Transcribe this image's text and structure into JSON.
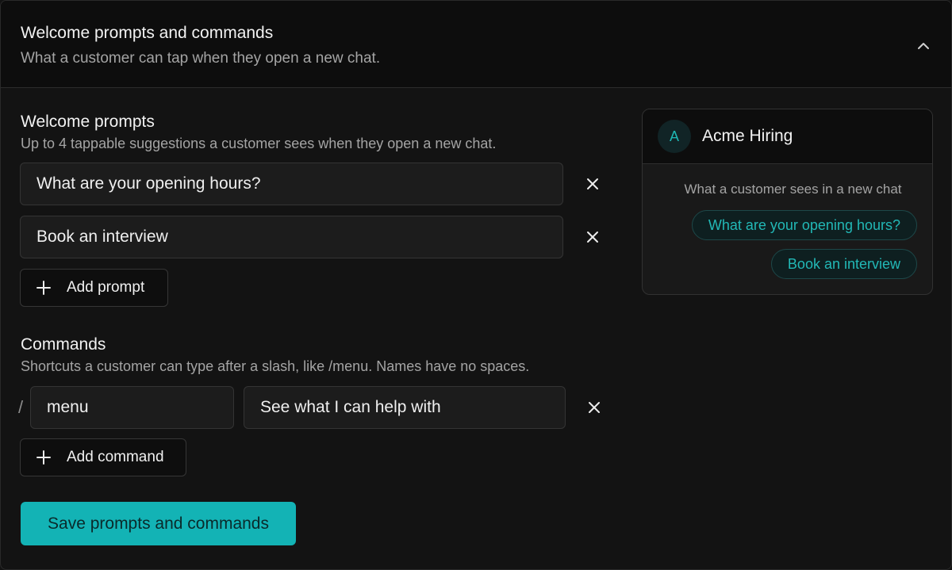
{
  "header": {
    "title": "Welcome prompts and commands",
    "subtitle": "What a customer can tap when they open a new chat."
  },
  "prompts": {
    "title": "Welcome prompts",
    "description": "Up to 4 tappable suggestions a customer sees when they open a new chat.",
    "items": [
      {
        "value": "What are your opening hours?"
      },
      {
        "value": "Book an interview"
      }
    ],
    "add_label": "Add prompt"
  },
  "commands": {
    "title": "Commands",
    "description": "Shortcuts a customer can type after a slash, like /menu. Names have no spaces.",
    "slash": "/",
    "items": [
      {
        "name": "menu",
        "description": "See what I can help with"
      }
    ],
    "add_label": "Add command"
  },
  "save_label": "Save prompts and commands",
  "preview": {
    "avatar_letter": "A",
    "name": "Acme Hiring",
    "caption": "What a customer sees in a new chat",
    "chips": [
      "What are your opening hours?",
      "Book an interview"
    ]
  },
  "icons": {
    "collapse": "chevron-up-icon",
    "remove": "close-icon",
    "add": "plus-icon"
  },
  "colors": {
    "accent": "#13b3b5",
    "background": "#131313",
    "header_background": "#0d0d0d"
  }
}
